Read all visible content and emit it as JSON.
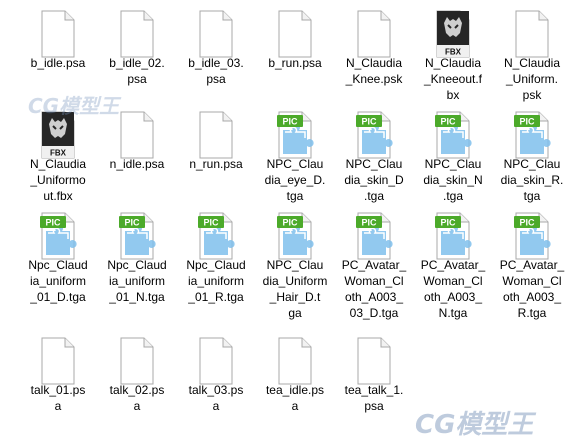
{
  "files": [
    {
      "name": "b_idle.psa",
      "type": "psa"
    },
    {
      "name": "b_idle_02.\npsa",
      "type": "psa"
    },
    {
      "name": "b_idle_03.\npsa",
      "type": "psa"
    },
    {
      "name": "b_run.psa",
      "type": "psa"
    },
    {
      "name": "N_Claudia\n_Knee.psk",
      "type": "psk"
    },
    {
      "name": "N_Claudia\n_Kneeout.f\nbx",
      "type": "fbx"
    },
    {
      "name": "N_Claudia\n_Uniform.\npsk",
      "type": "psk"
    },
    {
      "name": "N_Claudia\n_Uniformo\nut.fbx",
      "type": "fbx"
    },
    {
      "name": "n_idle.psa",
      "type": "psa"
    },
    {
      "name": "n_run.psa",
      "type": "psa"
    },
    {
      "name": "NPC_Clau\ndia_eye_D.\ntga",
      "type": "tga"
    },
    {
      "name": "NPC_Clau\ndia_skin_D\n.tga",
      "type": "tga"
    },
    {
      "name": "NPC_Clau\ndia_skin_N\n.tga",
      "type": "tga"
    },
    {
      "name": "NPC_Clau\ndia_skin_R.\ntga",
      "type": "tga"
    },
    {
      "name": "Npc_Claud\nia_uniform\n_01_D.tga",
      "type": "tga"
    },
    {
      "name": "Npc_Claud\nia_uniform\n_01_N.tga",
      "type": "tga"
    },
    {
      "name": "Npc_Claud\nia_uniform\n_01_R.tga",
      "type": "tga"
    },
    {
      "name": "NPC_Clau\ndia_Uniform\n_Hair_D.t\nga",
      "type": "tga"
    },
    {
      "name": "PC_Avatar_\nWoman_Cl\noth_A003_\n03_D.tga",
      "type": "tga"
    },
    {
      "name": "PC_Avatar_\nWoman_Cl\noth_A003_\nN.tga",
      "type": "tga"
    },
    {
      "name": "PC_Avatar_\nWoman_Cl\noth_A003_\nR.tga",
      "type": "tga"
    },
    {
      "name": "talk_01.ps\na",
      "type": "psa"
    },
    {
      "name": "talk_02.ps\na",
      "type": "psa"
    },
    {
      "name": "talk_03.ps\na",
      "type": "psa"
    },
    {
      "name": "tea_idle.ps\na",
      "type": "psa"
    },
    {
      "name": "tea_talk_1.\npsa",
      "type": "psa"
    }
  ],
  "icon_labels": {
    "fbx": "FBX",
    "tga": "PIC"
  },
  "colors": {
    "pic_green": "#4caa2a",
    "puzzle_blue": "#7fc0ec",
    "fbx_dark": "#262626"
  },
  "watermark": "CG模型王"
}
